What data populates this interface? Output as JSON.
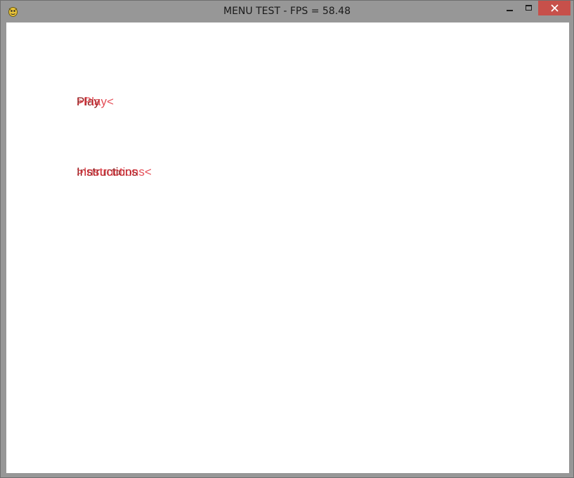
{
  "window": {
    "title": "MENU TEST - FPS = 58.48",
    "controls": {
      "minimize_icon": "minimize-icon",
      "maximize_icon": "maximize-icon",
      "close_icon": "close-icon",
      "close_color": "#c7504a"
    },
    "app_icon": "pygame-snake-icon"
  },
  "menu": {
    "items": [
      {
        "label": "Play",
        "selected_label": ">Play<"
      },
      {
        "label": "Instructions",
        "selected_label": ">Instructions<"
      }
    ],
    "colors": {
      "label": "#8a1a1a",
      "selected_label": "#e0303a",
      "background": "#ffffff"
    }
  }
}
